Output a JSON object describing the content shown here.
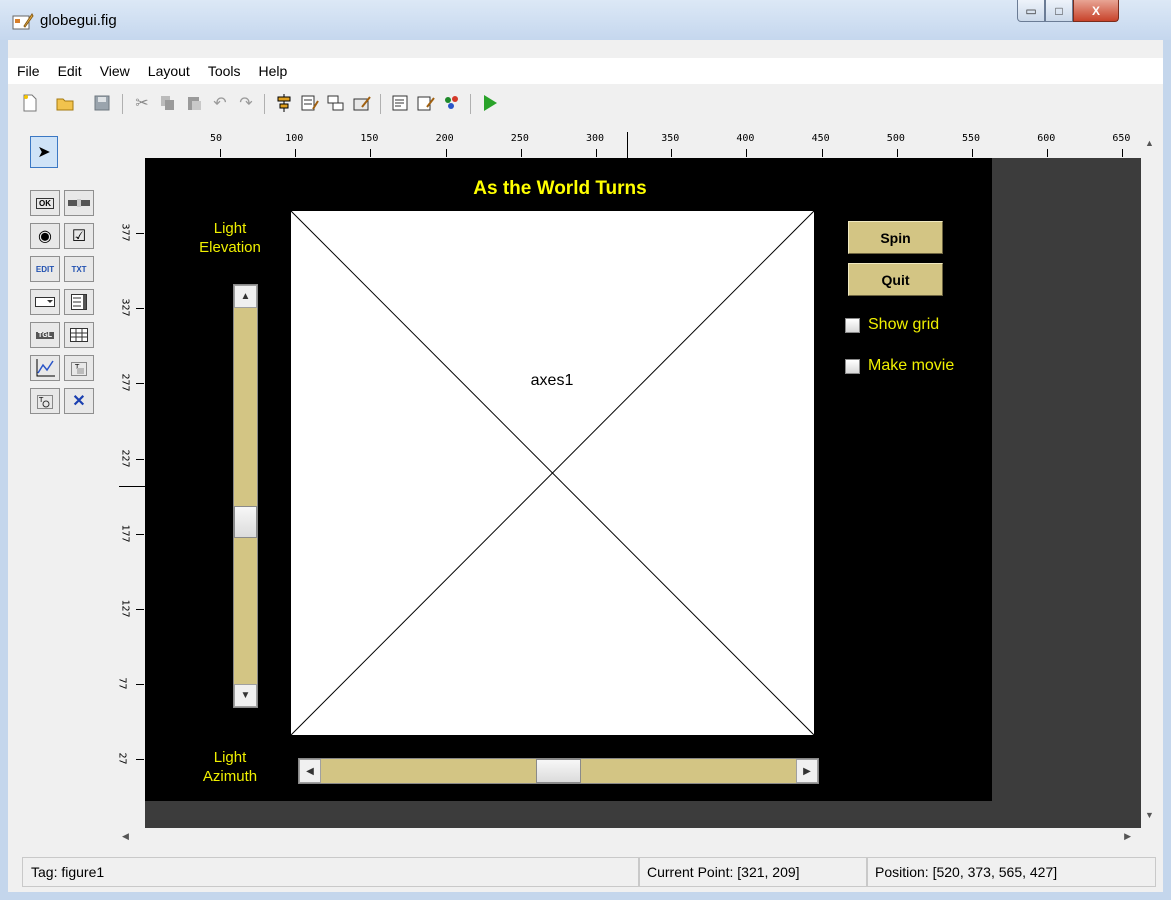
{
  "window": {
    "title": "globegui.fig",
    "min_glyph": "▭",
    "max_glyph": "□",
    "close_glyph": "X"
  },
  "menu": [
    "File",
    "Edit",
    "View",
    "Layout",
    "Tools",
    "Help"
  ],
  "toolbar": [
    "new-file",
    "open-folder",
    "save",
    "cut",
    "copy",
    "paste",
    "undo",
    "redo",
    "align",
    "menu-editor",
    "tab-order",
    "toolbar-editor",
    "mfile-editor",
    "property-inspector",
    "object-browser",
    "run"
  ],
  "palette": {
    "items": [
      "select",
      "push-button",
      "slider",
      "radio-button",
      "checkbox",
      "edit-text",
      "static-text",
      "popup-menu",
      "listbox",
      "toggle-button",
      "table",
      "axes",
      "panel",
      "button-group",
      "activex"
    ],
    "labels": {
      "push": "OK",
      "edit": "EDIT",
      "static": "TXT",
      "toggle": "TGL"
    }
  },
  "ruler_top_ticks": [
    "50",
    "100",
    "150",
    "200",
    "250",
    "300",
    "350",
    "400",
    "450",
    "500",
    "550",
    "600",
    "650"
  ],
  "ruler_left_ticks": [
    "377",
    "327",
    "277",
    "227",
    "177",
    "127",
    "77",
    "27"
  ],
  "figure": {
    "title": "As the World Turns",
    "elevation_label_1": "Light",
    "elevation_label_2": "Elevation",
    "azimuth_label_1": "Light",
    "azimuth_label_2": "Azimuth",
    "axes_label": "axes1",
    "spin_label": "Spin",
    "quit_label": "Quit",
    "show_grid_label": "Show grid",
    "make_movie_label": "Make movie",
    "elevation_value": 0.5,
    "azimuth_value": 0.5
  },
  "status": {
    "tag": "Tag: figure1",
    "current_point": "Current Point:  [321, 209]",
    "position": "Position: [520, 373, 565, 427]"
  },
  "colors": {
    "figure_bg": "#000000",
    "label_yellow": "#f0f000",
    "control_khaki": "#d3c584"
  }
}
